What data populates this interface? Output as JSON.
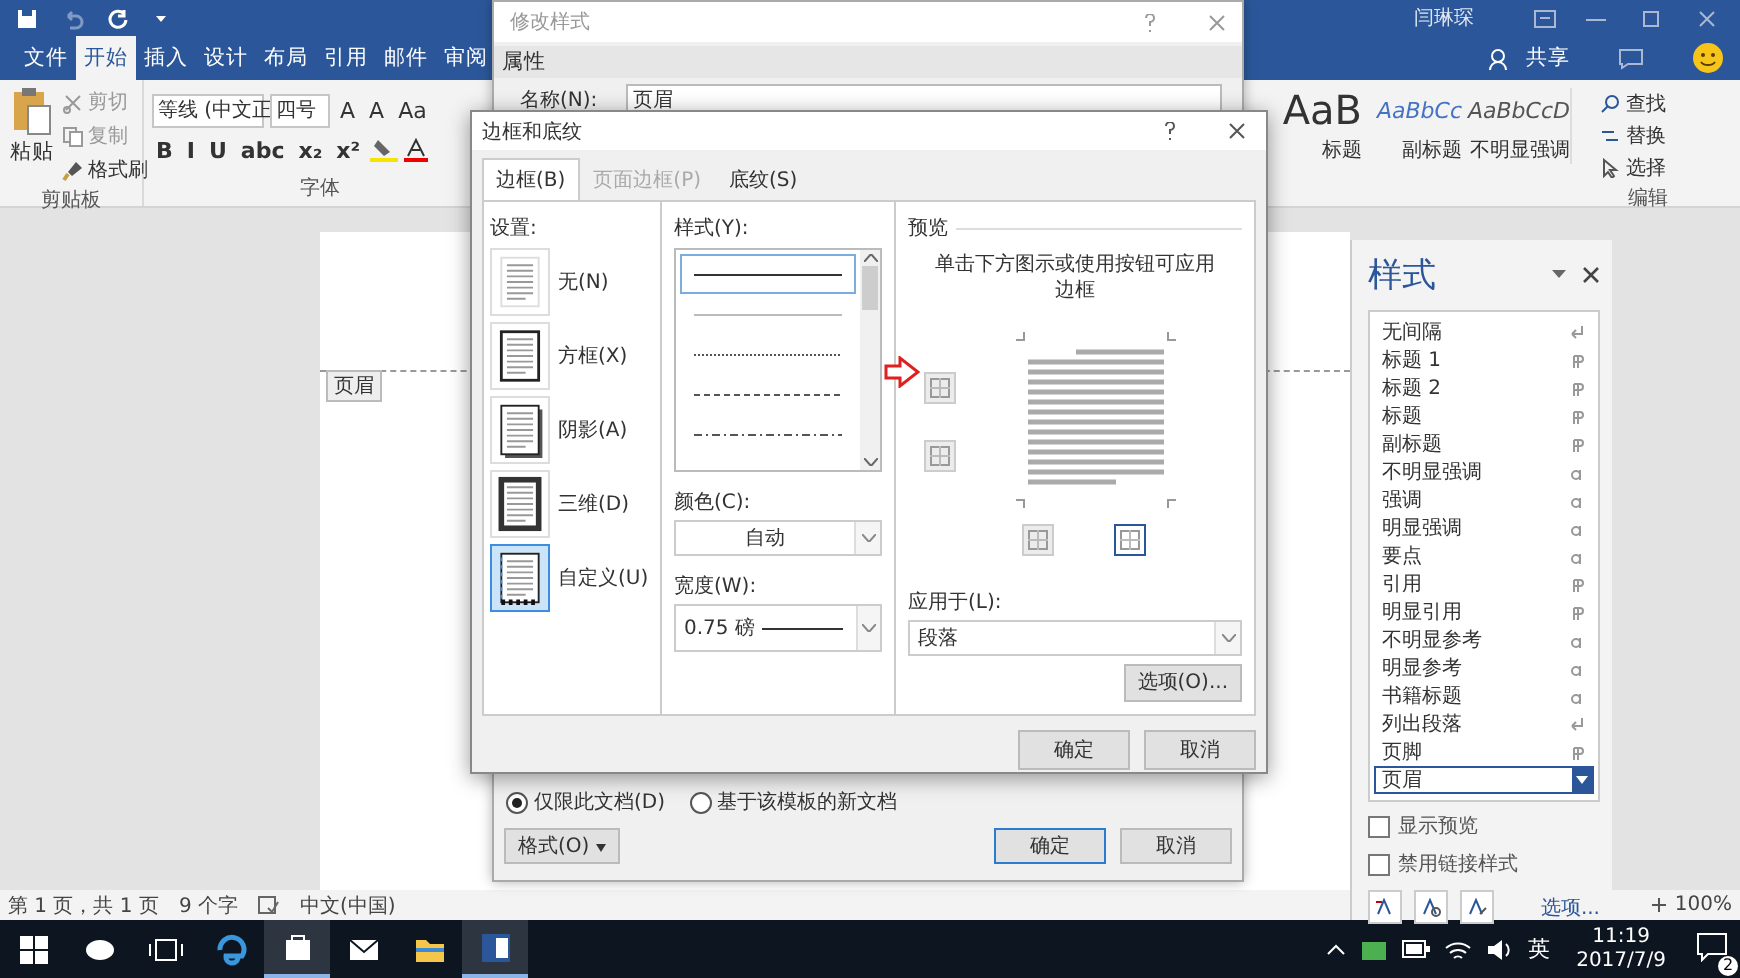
{
  "title_bar": {
    "user": "闫琳琛"
  },
  "ribbon": {
    "tabs": [
      {
        "label": "文件",
        "selected": false
      },
      {
        "label": "开始",
        "selected": true
      },
      {
        "label": "插入",
        "selected": false
      },
      {
        "label": "设计",
        "selected": false
      },
      {
        "label": "布局",
        "selected": false
      },
      {
        "label": "引用",
        "selected": false
      },
      {
        "label": "邮件",
        "selected": false
      },
      {
        "label": "审阅",
        "selected": false
      }
    ],
    "share": "共享",
    "clipboard": {
      "paste": "粘贴",
      "label": "剪贴板",
      "tools": [
        {
          "kind": "cut",
          "label": "剪切",
          "disabled": true
        },
        {
          "kind": "copy",
          "label": "复制",
          "disabled": true
        },
        {
          "kind": "brush",
          "label": "格式刷",
          "disabled": false
        }
      ]
    },
    "font": {
      "name": "等线 (中文正",
      "size": "四号",
      "size_buttons": [
        "A",
        "A",
        "Aa"
      ],
      "format_buttons": [
        "B",
        "I",
        "U",
        "abc",
        "x₂",
        "x²"
      ],
      "label": "字体"
    },
    "styles_gallery": [
      {
        "sample": "AaB",
        "name": "标题",
        "kind": "title"
      },
      {
        "sample": "AaBbCc",
        "name": "副标题",
        "kind": "subtitle"
      },
      {
        "sample": "AaBbCcD",
        "name": "不明显强调",
        "kind": "emphasis"
      }
    ],
    "editing": {
      "find": "查找",
      "replace": "替换",
      "select": "选择",
      "label": "编辑"
    }
  },
  "document": {
    "header_tag": "页眉"
  },
  "styles_pane": {
    "title": "样式",
    "items": [
      {
        "name": "无间隔",
        "kind": "paragraph",
        "selected": false
      },
      {
        "name": "标题 1",
        "kind": "linked",
        "selected": false
      },
      {
        "name": "标题 2",
        "kind": "linked",
        "selected": false
      },
      {
        "name": "标题",
        "kind": "linked",
        "selected": false
      },
      {
        "name": "副标题",
        "kind": "linked",
        "selected": false
      },
      {
        "name": "不明显强调",
        "kind": "character",
        "selected": false
      },
      {
        "name": "强调",
        "kind": "character",
        "selected": false
      },
      {
        "name": "明显强调",
        "kind": "character",
        "selected": false
      },
      {
        "name": "要点",
        "kind": "character",
        "selected": false
      },
      {
        "name": "引用",
        "kind": "linked",
        "selected": false
      },
      {
        "name": "明显引用",
        "kind": "linked",
        "selected": false
      },
      {
        "name": "不明显参考",
        "kind": "character",
        "selected": false
      },
      {
        "name": "明显参考",
        "kind": "character",
        "selected": false
      },
      {
        "name": "书籍标题",
        "kind": "character",
        "selected": false
      },
      {
        "name": "列出段落",
        "kind": "paragraph",
        "selected": false
      },
      {
        "name": "页脚",
        "kind": "linked",
        "selected": false
      },
      {
        "name": "页眉",
        "selected": true
      }
    ],
    "options": [
      {
        "label": "显示预览",
        "checked": false
      },
      {
        "label": "禁用链接样式",
        "checked": false
      }
    ],
    "link": "选项..."
  },
  "modify_dialog": {
    "title": "修改样式",
    "section": "属性",
    "name_label": "名称(N):",
    "name_value": "页眉",
    "scope": [
      {
        "label": "仅限此文档(D)",
        "selected": true
      },
      {
        "label": "基于该模板的新文档",
        "selected": false
      }
    ],
    "format_button": "格式(O)",
    "ok": "确定",
    "cancel": "取消"
  },
  "borders_dialog": {
    "title": "边框和底纹",
    "tabs": [
      {
        "label": "边框(B)",
        "selected": true,
        "disabled": false
      },
      {
        "label": "页面边框(P)",
        "selected": false,
        "disabled": true
      },
      {
        "label": "底纹(S)",
        "selected": false,
        "disabled": false
      }
    ],
    "setting_label": "设置:",
    "settings": [
      {
        "label": "无(N)",
        "kind": "none",
        "selected": false
      },
      {
        "label": "方框(X)",
        "kind": "box",
        "selected": false
      },
      {
        "label": "阴影(A)",
        "kind": "shadow",
        "selected": false
      },
      {
        "label": "三维(D)",
        "kind": "raised",
        "selected": false
      },
      {
        "label": "自定义(U)",
        "kind": "custom",
        "selected": true
      }
    ],
    "style_label": "样式(Y):",
    "line_styles": [
      {
        "kind": "solid",
        "selected": true
      },
      {
        "kind": "thin",
        "selected": false
      },
      {
        "kind": "dotted",
        "selected": false
      },
      {
        "kind": "dashed",
        "selected": false
      },
      {
        "kind": "dashdot",
        "selected": false
      }
    ],
    "color_label": "颜色(C):",
    "color_value": "自动",
    "width_label": "宽度(W):",
    "width_value": "0.75 磅",
    "preview_label": "预览",
    "preview_hint": "单击下方图示或使用按钮可应用边框",
    "border_buttons": [
      {
        "on": false
      },
      {
        "on": false
      },
      {
        "on": false
      },
      {
        "on": true
      }
    ],
    "apply_label": "应用于(L):",
    "apply_value": "段落",
    "options_button": "选项(O)...",
    "ok": "确定",
    "cancel": "取消"
  },
  "status_bar": {
    "page": "第 1 页，共 1 页",
    "words": "9 个字",
    "language": "中文(中国)",
    "zoom": "100%"
  },
  "taskbar": {
    "apps": [
      {
        "kind": "browser",
        "open": false
      },
      {
        "kind": "store",
        "open": true
      },
      {
        "kind": "mail",
        "open": false
      },
      {
        "kind": "folder",
        "open": false
      },
      {
        "kind": "word",
        "open": true
      }
    ],
    "ime": "英",
    "time": "11:19",
    "date": "2017/7/9",
    "notifications": "2"
  }
}
